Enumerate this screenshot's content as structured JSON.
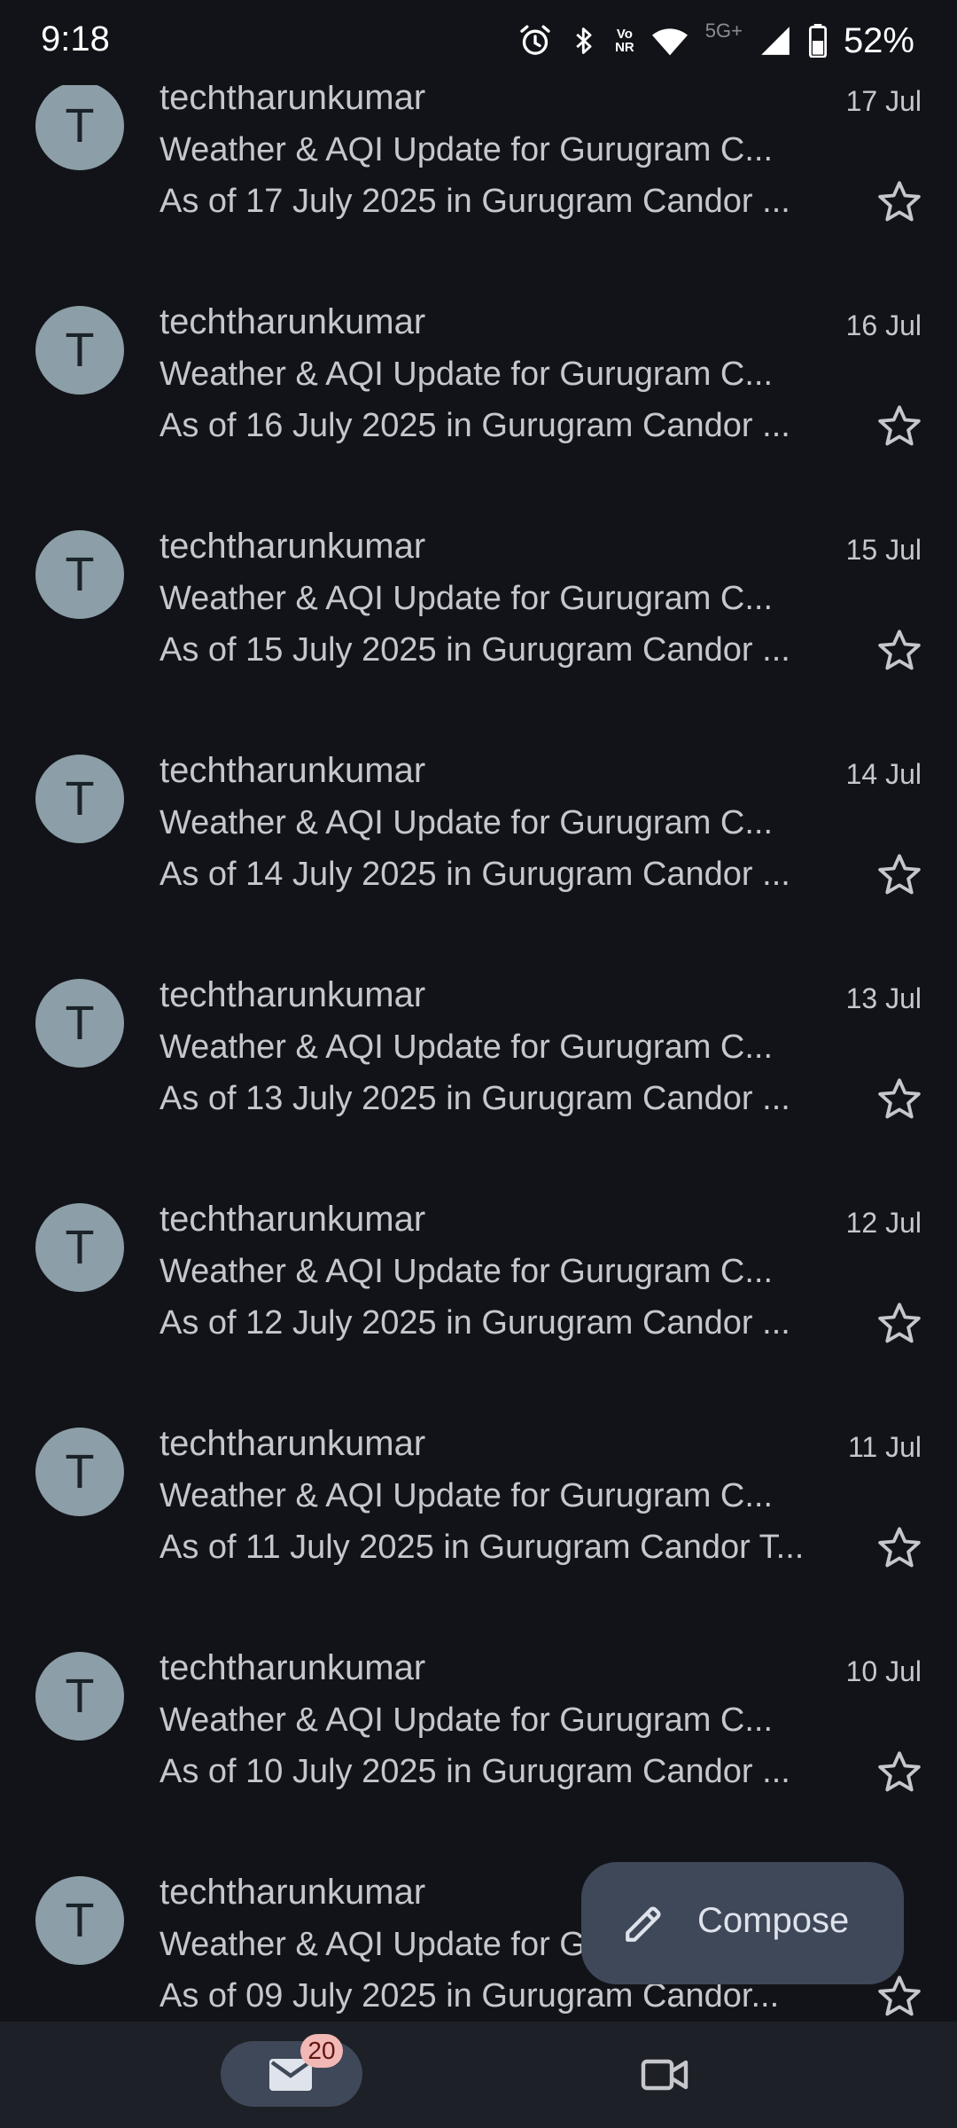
{
  "status_bar": {
    "time": "9:18",
    "network_label": "5G+",
    "volte_top": "Vo",
    "volte_bottom": "NR",
    "battery": "52%"
  },
  "emails": [
    {
      "avatar": "T",
      "sender": "techtharunkumar",
      "date": "17 Jul",
      "subject": "Weather & AQI Update for Gurugram C...",
      "snippet": "As of 17 July 2025 in Gurugram Candor ...",
      "starred": false
    },
    {
      "avatar": "T",
      "sender": "techtharunkumar",
      "date": "16 Jul",
      "subject": "Weather & AQI Update for Gurugram C...",
      "snippet": "As of 16 July 2025 in Gurugram Candor ...",
      "starred": false
    },
    {
      "avatar": "T",
      "sender": "techtharunkumar",
      "date": "15 Jul",
      "subject": "Weather & AQI Update for Gurugram C...",
      "snippet": "As of 15 July 2025 in Gurugram Candor ...",
      "starred": false
    },
    {
      "avatar": "T",
      "sender": "techtharunkumar",
      "date": "14 Jul",
      "subject": "Weather & AQI Update for Gurugram C...",
      "snippet": "As of 14 July 2025 in Gurugram Candor ...",
      "starred": false
    },
    {
      "avatar": "T",
      "sender": "techtharunkumar",
      "date": "13 Jul",
      "subject": "Weather & AQI Update for Gurugram C...",
      "snippet": "As of 13 July 2025 in Gurugram Candor ...",
      "starred": false
    },
    {
      "avatar": "T",
      "sender": "techtharunkumar",
      "date": "12 Jul",
      "subject": "Weather & AQI Update for Gurugram C...",
      "snippet": "As of 12 July 2025 in Gurugram Candor ...",
      "starred": false
    },
    {
      "avatar": "T",
      "sender": "techtharunkumar",
      "date": "11 Jul",
      "subject": "Weather & AQI Update for Gurugram C...",
      "snippet": "As of 11 July 2025 in Gurugram Candor T...",
      "starred": false
    },
    {
      "avatar": "T",
      "sender": "techtharunkumar",
      "date": "10 Jul",
      "subject": "Weather & AQI Update for Gurugram C...",
      "snippet": "As of 10 July 2025 in Gurugram Candor ...",
      "starred": false
    },
    {
      "avatar": "T",
      "sender": "techtharunkumar",
      "date": "",
      "subject": "Weather & AQI Update for Gurugram C...",
      "snippet": "As of 09 July 2025 in Gurugram Candor...",
      "starred": false
    }
  ],
  "compose": {
    "label": "Compose",
    "icon": "pencil-icon"
  },
  "bottom_nav": {
    "mail_icon": "mail-icon",
    "mail_badge": "20",
    "meet_icon": "video-camera-icon"
  },
  "colors": {
    "background": "#121318",
    "avatar": "#8c9ea7",
    "fab": "#3f4858",
    "badge": "#f2b8b5",
    "nav": "#1d2026"
  }
}
